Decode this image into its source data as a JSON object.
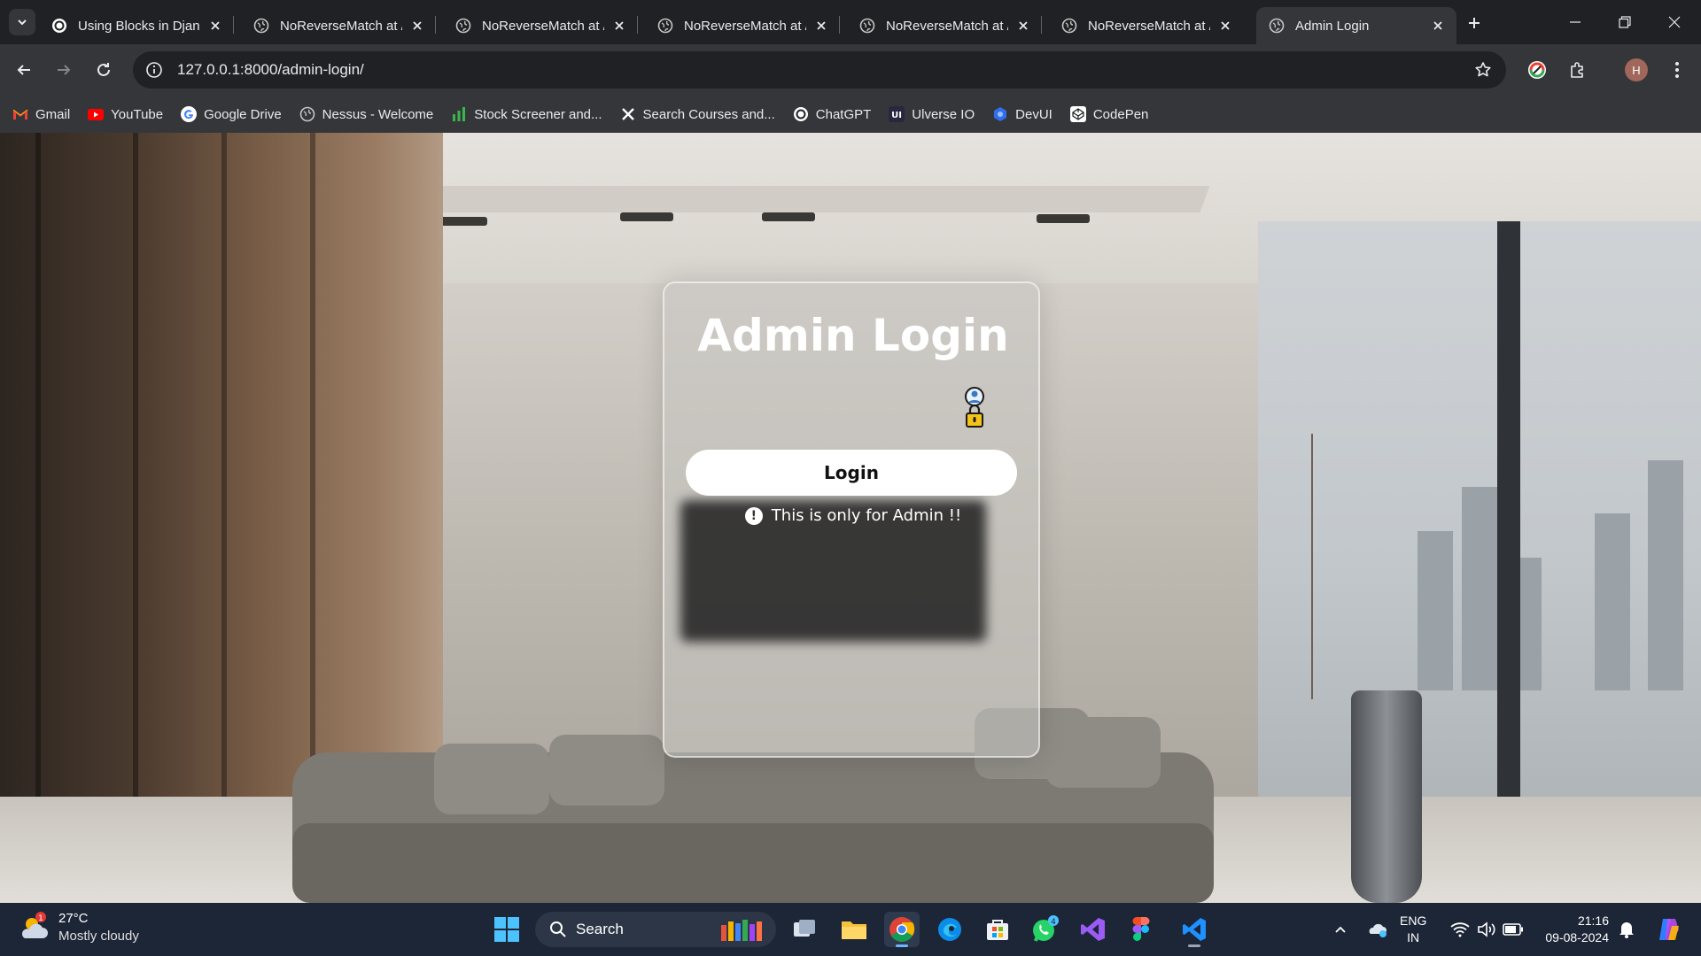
{
  "browser": {
    "tabs": [
      {
        "title": "Using Blocks in Django",
        "favicon": "chatgpt-icon",
        "active": false
      },
      {
        "title": "NoReverseMatch at /",
        "favicon": "globe-icon",
        "active": false
      },
      {
        "title": "NoReverseMatch at /",
        "favicon": "globe-icon",
        "active": false
      },
      {
        "title": "NoReverseMatch at /",
        "favicon": "globe-icon",
        "active": false
      },
      {
        "title": "NoReverseMatch at /",
        "favicon": "globe-icon",
        "active": false
      },
      {
        "title": "NoReverseMatch at /",
        "favicon": "globe-icon",
        "active": false
      },
      {
        "title": "Admin Login",
        "favicon": "globe-icon",
        "active": true
      }
    ],
    "url": "127.0.0.1:8000/admin-login/",
    "profile_initial": "H",
    "bookmarks": [
      {
        "label": "Gmail",
        "icon": "gmail-icon"
      },
      {
        "label": "YouTube",
        "icon": "youtube-icon"
      },
      {
        "label": "Google Drive",
        "icon": "google-icon"
      },
      {
        "label": "Nessus - Welcome",
        "icon": "globe-icon"
      },
      {
        "label": "Stock Screener and...",
        "icon": "chart-bars-icon"
      },
      {
        "label": "Search Courses and...",
        "icon": "x-logo-icon"
      },
      {
        "label": "ChatGPT",
        "icon": "chatgpt-icon"
      },
      {
        "label": "Ulverse IO",
        "icon": "uiverse-icon"
      },
      {
        "label": "DevUI",
        "icon": "devui-icon"
      },
      {
        "label": "CodePen",
        "icon": "codepen-icon"
      }
    ]
  },
  "page": {
    "title": "Admin Login",
    "login_button": "Login",
    "notice": "This is only for Admin !!",
    "notice_icon": "!"
  },
  "taskbar": {
    "weather_badge": "1",
    "temperature": "27°C",
    "condition": "Mostly cloudy",
    "search_label": "Search",
    "whatsapp_badge": "4",
    "lang_line1": "ENG",
    "lang_line2": "IN",
    "time": "21:16",
    "date": "09-08-2024"
  },
  "colors": {
    "chrome_bg": "#202124",
    "toolbar_bg": "#35363a",
    "taskbar_bg": "#1d2637",
    "button_bg": "#ffffff"
  }
}
